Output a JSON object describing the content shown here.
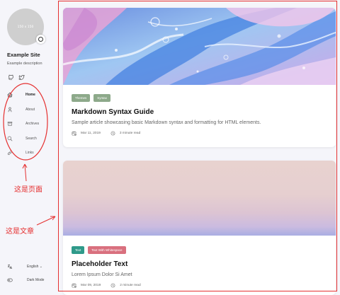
{
  "sidebar": {
    "avatar_text": "150 x 150",
    "site_title": "Example Site",
    "site_description": "Example description",
    "social": [
      "github-icon",
      "twitter-icon"
    ],
    "menu": [
      {
        "label": "Home",
        "icon": "home-icon",
        "active": true
      },
      {
        "label": "About",
        "icon": "user-icon",
        "active": false
      },
      {
        "label": "Archives",
        "icon": "archive-icon",
        "active": false
      },
      {
        "label": "Search",
        "icon": "search-icon",
        "active": false
      },
      {
        "label": "Links",
        "icon": "link-icon",
        "active": false
      }
    ],
    "language_label": "English",
    "dark_mode_label": "Dark Mode"
  },
  "annotations": {
    "pages_note": "这是页面",
    "articles_note": "这是文章",
    "color": "#e53030"
  },
  "articles": [
    {
      "tags": [
        {
          "label": "Themes",
          "color": "#8da98a"
        },
        {
          "label": "Syntax",
          "color": "#8da98a"
        }
      ],
      "title": "Markdown Syntax Guide",
      "subtitle": "Sample article showcasing basic Markdown syntax and formatting for HTML elements.",
      "date": "Mar 11, 2019",
      "read_time": "3 minute read"
    },
    {
      "tags": [
        {
          "label": "Text",
          "color": "#2f9a8a"
        },
        {
          "label": "Text With Whitespace",
          "color": "#d9707e"
        }
      ],
      "title": "Placeholder Text",
      "subtitle": "Lorem Ipsum Dolor Si Amet",
      "date": "Mar 09, 2019",
      "read_time": "2 minute read"
    }
  ]
}
